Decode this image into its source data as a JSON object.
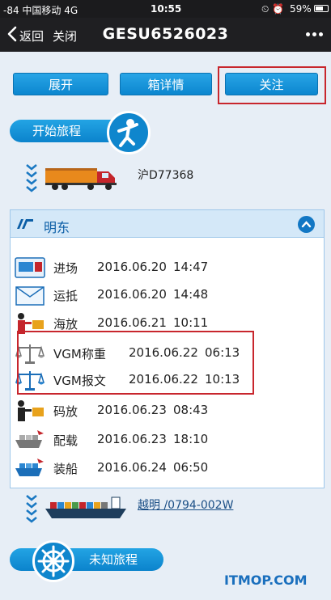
{
  "status_bar": {
    "carrier": "-84 中国移动  4G",
    "time": "10:55",
    "icons": "⏲ ⏰",
    "battery": "59%"
  },
  "nav": {
    "back": "返回",
    "close": "关闭",
    "title": "GESU6526023"
  },
  "actions": {
    "expand": "展开",
    "box_detail": "箱详情",
    "follow": "关注"
  },
  "journey": {
    "start_label": "开始旅程",
    "truck_plate": "沪D77368",
    "vessel_voyage": "越明 /0794-002W",
    "end_label": "未知旅程"
  },
  "terminal": {
    "name": "明东"
  },
  "events": [
    {
      "name": "进场",
      "date": "2016.06.20",
      "time": "14:47",
      "icon": "gate-in-icon"
    },
    {
      "name": "运抵",
      "date": "2016.06.20",
      "time": "14:48",
      "icon": "envelope-icon"
    },
    {
      "name": "海放",
      "date": "2016.06.21",
      "time": "10:11",
      "icon": "customs-officer-icon"
    },
    {
      "name": "VGM称重",
      "date": "2016.06.22",
      "time": "06:13",
      "icon": "scale-icon"
    },
    {
      "name": "VGM报文",
      "date": "2016.06.22",
      "time": "10:13",
      "icon": "scale-icon"
    },
    {
      "name": "码放",
      "date": "2016.06.23",
      "time": "08:43",
      "icon": "terminal-officer-icon"
    },
    {
      "name": "配载",
      "date": "2016.06.23",
      "time": "18:10",
      "icon": "ship-planning-icon"
    },
    {
      "name": "装船",
      "date": "2016.06.24",
      "time": "06:50",
      "icon": "ship-loading-icon"
    }
  ],
  "watermark": "ITMOP.COM",
  "colors": {
    "accent_blue": "#0b86cf",
    "highlight_red": "#c8262d",
    "page_bg": "#e7eef6",
    "nav_bg": "#1f1f22"
  }
}
